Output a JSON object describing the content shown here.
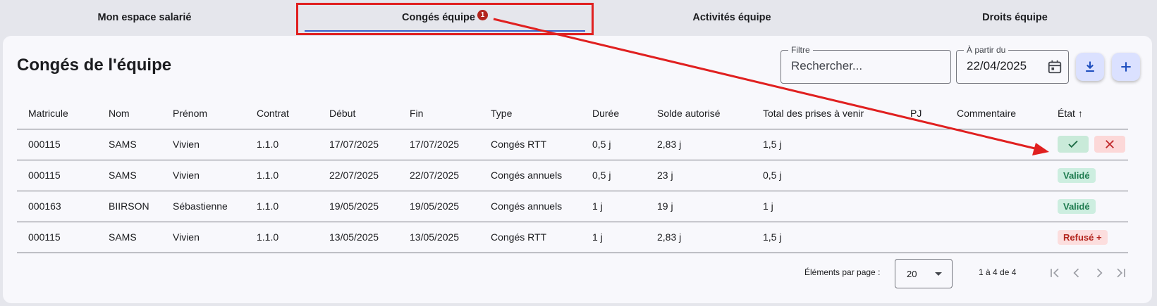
{
  "tabs": [
    {
      "label": "Mon espace salarié"
    },
    {
      "label": "Congés équipe",
      "badge": "1"
    },
    {
      "label": "Activités équipe"
    },
    {
      "label": "Droits équipe"
    }
  ],
  "page": {
    "title": "Congés de l'équipe"
  },
  "filter": {
    "legend": "Filtre",
    "placeholder": "Rechercher..."
  },
  "date_from": {
    "legend": "À partir du",
    "value": "22/04/2025"
  },
  "table": {
    "headers": {
      "matricule": "Matricule",
      "nom": "Nom",
      "prenom": "Prénom",
      "contrat": "Contrat",
      "debut": "Début",
      "fin": "Fin",
      "type": "Type",
      "duree": "Durée",
      "solde": "Solde autorisé",
      "total": "Total des prises à venir",
      "pj": "PJ",
      "commentaire": "Commentaire",
      "etat": "État"
    },
    "rows": [
      {
        "matricule": "000115",
        "nom": "SAMS",
        "prenom": "Vivien",
        "contrat": "1.1.0",
        "debut": "17/07/2025",
        "fin": "17/07/2025",
        "type": "Congés RTT",
        "duree": "0,5 j",
        "solde": "2,83 j",
        "total": "1,5 j",
        "pj": "",
        "commentaire": "",
        "etat": ""
      },
      {
        "matricule": "000115",
        "nom": "SAMS",
        "prenom": "Vivien",
        "contrat": "1.1.0",
        "debut": "22/07/2025",
        "fin": "22/07/2025",
        "type": "Congés annuels",
        "duree": "0,5 j",
        "solde": "23 j",
        "total": "0,5 j",
        "pj": "",
        "commentaire": "",
        "etat": "Validé"
      },
      {
        "matricule": "000163",
        "nom": "BIIRSON",
        "prenom": "Sébastienne",
        "contrat": "1.1.0",
        "debut": "19/05/2025",
        "fin": "19/05/2025",
        "type": "Congés annuels",
        "duree": "1 j",
        "solde": "19 j",
        "total": "1 j",
        "pj": "",
        "commentaire": "",
        "etat": "Validé"
      },
      {
        "matricule": "000115",
        "nom": "SAMS",
        "prenom": "Vivien",
        "contrat": "1.1.0",
        "debut": "13/05/2025",
        "fin": "13/05/2025",
        "type": "Congés RTT",
        "duree": "1 j",
        "solde": "2,83 j",
        "total": "1,5 j",
        "pj": "",
        "commentaire": "",
        "etat": "Refusé +"
      }
    ]
  },
  "paginator": {
    "label": "Éléments par page :",
    "page_size": "20",
    "range": "1 à 4 de 4"
  },
  "colors": {
    "accent": "#3a5fc8",
    "annotation": "#e02020",
    "ok": "#1e7b4f",
    "ko": "#b3261e"
  }
}
